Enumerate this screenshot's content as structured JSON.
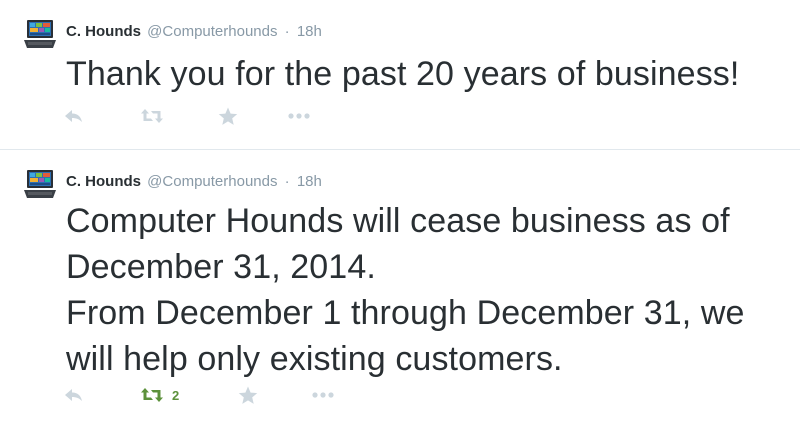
{
  "colors": {
    "name": "#292f33",
    "meta": "#8899a6",
    "action": "#ccd6dd",
    "retweeted": "#5c913b",
    "divider": "#e1e8ed"
  },
  "tweets": [
    {
      "fullname": "C. Hounds",
      "screenname": "@Computerhounds",
      "separator": "·",
      "time": "18h",
      "text_lines": [
        "Thank you for the past 20 years of business!"
      ],
      "retweet_count": "",
      "retweeted": false,
      "avatar_icon": "laptop-avatar-icon"
    },
    {
      "fullname": "C. Hounds",
      "screenname": "@Computerhounds",
      "separator": "·",
      "time": "18h",
      "text_lines": [
        "Computer Hounds will cease business as of",
        "December 31, 2014.",
        "From December 1 through December 31, we",
        "will help only existing customers."
      ],
      "retweet_count": "2",
      "retweeted": true,
      "avatar_icon": "laptop-avatar-icon"
    }
  ],
  "action_icons": [
    "reply-icon",
    "retweet-icon",
    "favorite-icon",
    "more-icon"
  ]
}
